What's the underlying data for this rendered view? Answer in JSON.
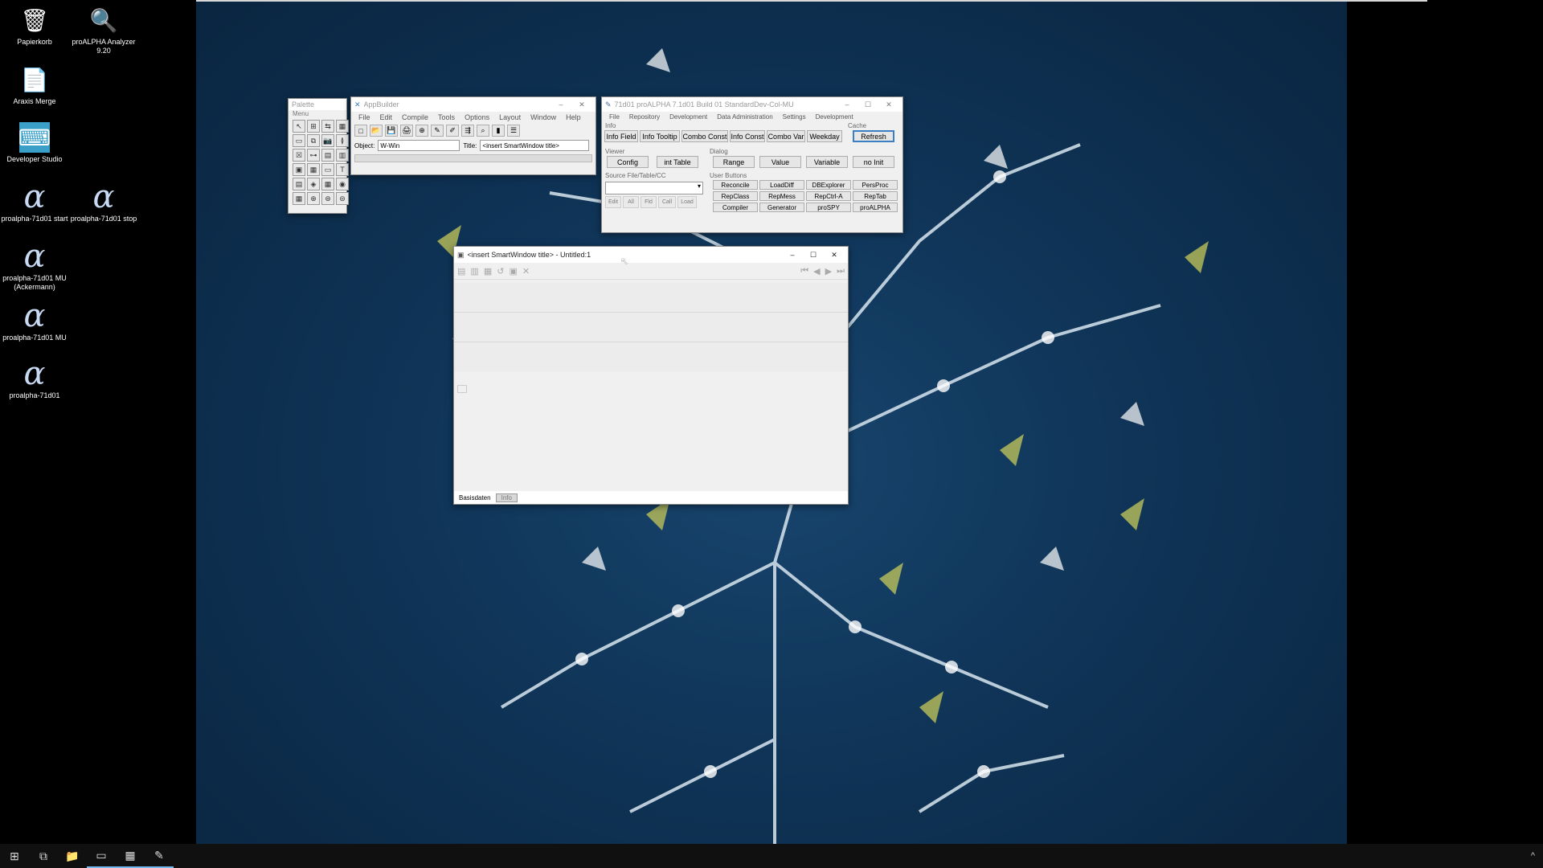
{
  "desktop": {
    "icons": [
      {
        "label": "Papierkorb",
        "glyph": "🗑"
      },
      {
        "label": "proALPHA Analyzer 9.20",
        "glyph": "🔍"
      },
      {
        "label": "Araxis Merge",
        "glyph": "📄"
      },
      {
        "label": "Developer Studio",
        "glyph": "⌨"
      },
      {
        "label": "proalpha-71d01 start",
        "glyph": "α"
      },
      {
        "label": "proalpha-71d01 stop",
        "glyph": "α"
      },
      {
        "label": "proalpha-71d01 MU (Ackermann)",
        "glyph": "α"
      },
      {
        "label": "proalpha-71d01 MU",
        "glyph": "α"
      },
      {
        "label": "proalpha-71d01",
        "glyph": "α"
      }
    ]
  },
  "palette": {
    "title": "Palette",
    "menu": "Menu",
    "tools": [
      "↖",
      "⊞",
      "⇆",
      "▦",
      "▭",
      "⧉",
      "📷",
      "≬",
      "☒",
      "⊶",
      "▤",
      "▥",
      "▣",
      "▦",
      "▭",
      "T",
      "▤",
      "◈",
      "▦",
      "◉",
      "▦",
      "⊕",
      "⊛",
      "⊜"
    ]
  },
  "appbuilder": {
    "title": "AppBuilder",
    "menus": [
      "File",
      "Edit",
      "Compile",
      "Tools",
      "Options",
      "Layout",
      "Window",
      "Help"
    ],
    "object_label": "Object:",
    "object_value": "W-Win",
    "title_label": "Title:",
    "title_value": "<insert SmartWindow title>",
    "toolbar_icons": [
      "□",
      "📂",
      "💾",
      "🖨",
      "⊕",
      "✎",
      "✐",
      "⇶",
      "⌕",
      "▮",
      "☰"
    ]
  },
  "proalpha_tools": {
    "title": "71d01 proALPHA 7.1d01 Build 01 StandardDev-Col-MU",
    "menus": [
      "File",
      "Repository",
      "Development",
      "Data Administration",
      "Settings",
      "Development"
    ],
    "info_group": "Info",
    "info_buttons": [
      "Info Field",
      "Info Tooltip",
      "Combo Const",
      "Info Const",
      "Combo Var",
      "Weekday"
    ],
    "cache_group": "Cache",
    "refresh": "Refresh",
    "viewer_group": "Viewer",
    "viewer_buttons": [
      "Config",
      "int Table"
    ],
    "dialog_group": "Dialog",
    "dialog_buttons": [
      "Range",
      "Value",
      "Variable",
      "no Init"
    ],
    "source_group": "Source File/Table/CC",
    "source_buttons": [
      "Edit",
      "All",
      "Fld",
      "Call",
      "Load"
    ],
    "user_group": "User Buttons",
    "user_buttons": [
      "Reconcile",
      "LoadDiff",
      "DBExplorer",
      "PersProc",
      "RepClass",
      "RepMess",
      "RepCtrl-A",
      "RepTab",
      "Compiler",
      "Generator",
      "proSPY",
      "proALPHA"
    ]
  },
  "smartwindow": {
    "title": "<insert SmartWindow title> - Untitled:1",
    "tabs": [
      "Basisdaten",
      "Info"
    ]
  },
  "taskbar": {
    "items": [
      "start-icon",
      "task-view-icon",
      "file-explorer-icon",
      "terminal-icon",
      "developer-studio-icon",
      "proalpha-tool-icon"
    ],
    "glyphs": [
      "⊞",
      "⧉",
      "📁",
      "▭",
      "▦",
      "✎"
    ],
    "tray": "^"
  }
}
